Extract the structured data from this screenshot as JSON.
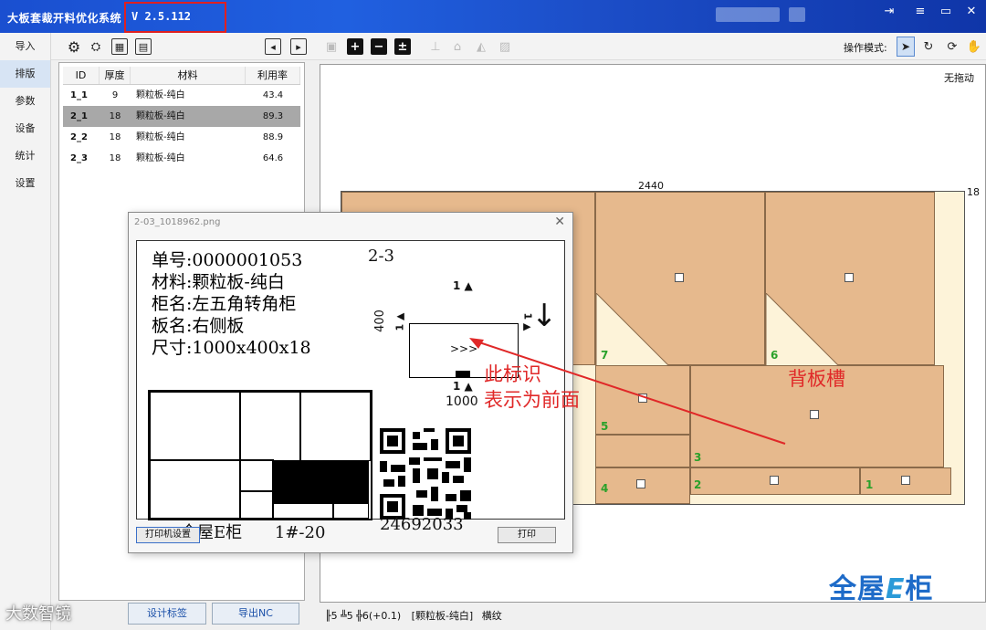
{
  "app": {
    "title": "大板套裁开料优化系统",
    "version": "V 2.5.112"
  },
  "window_controls": [
    "⇥",
    "≡",
    "▭",
    "✕"
  ],
  "nav": {
    "items": [
      {
        "label": "导入",
        "active": false
      },
      {
        "label": "排版",
        "active": true
      },
      {
        "label": "参数",
        "active": false
      },
      {
        "label": "设备",
        "active": false
      },
      {
        "label": "统计",
        "active": false
      },
      {
        "label": "设置",
        "active": false
      }
    ]
  },
  "toolbar": {
    "op_mode_label": "操作模式:"
  },
  "table": {
    "headers": [
      "ID",
      "厚度",
      "材料",
      "利用率"
    ],
    "rows": [
      {
        "id": "1_1",
        "thickness": "9",
        "material": "颗粒板-纯白",
        "rate": "43.4"
      },
      {
        "id": "2_1",
        "thickness": "18",
        "material": "颗粒板-纯白",
        "rate": "89.3"
      },
      {
        "id": "2_2",
        "thickness": "18",
        "material": "颗粒板-纯白",
        "rate": "88.9"
      },
      {
        "id": "2_3",
        "thickness": "18",
        "material": "颗粒板-纯白",
        "rate": "64.6"
      }
    ],
    "selected_index": 1
  },
  "bottom_buttons": {
    "design_label": "设计标签",
    "export_nc": "导出NC"
  },
  "canvas": {
    "drag_mode": "无拖动",
    "width_dim": "2440",
    "height_dim": "18",
    "piece_numbers": [
      "7",
      "6",
      "5",
      "3",
      "2",
      "4",
      "1"
    ],
    "status": {
      "a": "╟5",
      "b": "╩5",
      "c": "╬6(+0.1)",
      "material": "[颗粒板-纯白]",
      "grain": "横纹"
    }
  },
  "brand": {
    "prefix": "全屋",
    "e": "E",
    "suffix": "柜"
  },
  "dialog": {
    "title": "2-03_1018962.png",
    "order_no": "单号:0000001053",
    "code": "2-3",
    "material": "材料:颗粒板-纯白",
    "cabinet": "柜名:左五角转角柜",
    "panel": "板名:右侧板",
    "size": "尺寸:1000x400x18",
    "dim_width": "1000",
    "dim_height": "400",
    "edge_mark": "1 ▲",
    "arrows": ">>>",
    "footer_left": "全屋E柜",
    "footer_right": "1#-20",
    "qr_number": "24692033",
    "btn_printer_settings": "打印机设置",
    "btn_print": "打印"
  },
  "annotations": {
    "front_mark_line1": "此标识",
    "front_mark_line2": "表示为前面",
    "back_groove": "背板槽"
  },
  "watermark": "大数智镜",
  "colors": {
    "title_blue": "#1a4fd0",
    "piece": "#e6b98d",
    "board_bg": "#fdf3d9",
    "annotation_red": "#e02828",
    "piece_number": "#2aa12a",
    "brand_blue": "#1e6bc8"
  }
}
